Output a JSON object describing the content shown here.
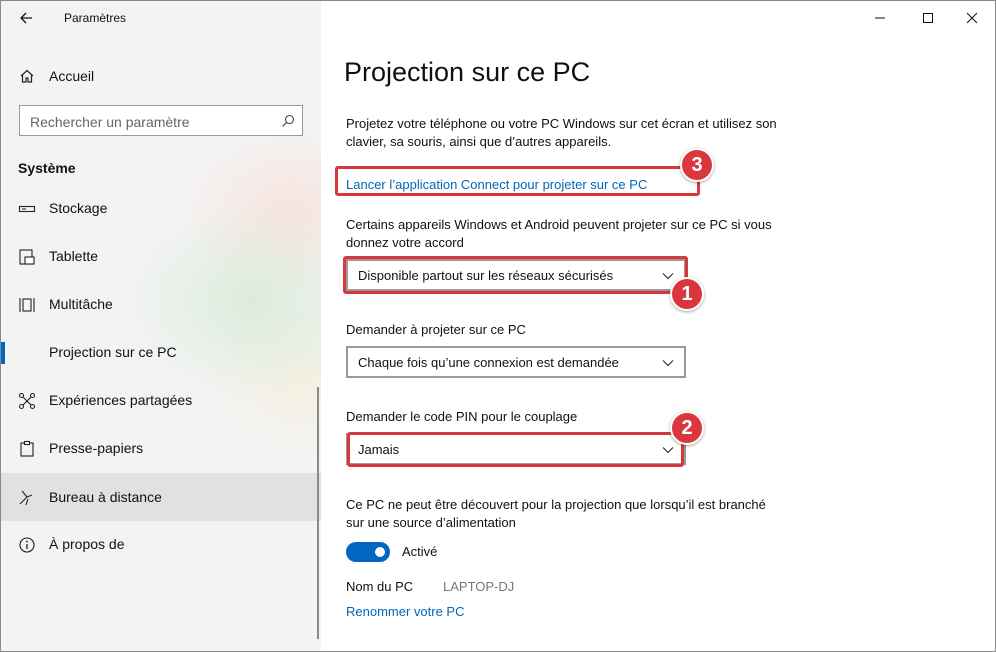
{
  "window": {
    "app_title": "Paramètres"
  },
  "sidebar": {
    "home_label": "Accueil",
    "search_placeholder": "Rechercher un paramètre",
    "section_title": "Système",
    "items": [
      {
        "label": "Stockage",
        "icon": "storage-icon"
      },
      {
        "label": "Tablette",
        "icon": "tablet-icon"
      },
      {
        "label": "Multitâche",
        "icon": "multitask-icon"
      },
      {
        "label": "Projection sur ce PC",
        "icon": "projection-icon",
        "active": true
      },
      {
        "label": "Expériences partagées",
        "icon": "shared-experiences-icon"
      },
      {
        "label": "Presse-papiers",
        "icon": "clipboard-icon"
      },
      {
        "label": "Bureau à distance",
        "icon": "remote-desktop-icon",
        "hovered": true
      },
      {
        "label": "À propos de",
        "icon": "info-icon"
      }
    ]
  },
  "main": {
    "title": "Projection sur ce PC",
    "intro": "Projetez votre téléphone ou votre PC Windows sur cet écran et utilisez son clavier, sa souris, ainsi que d’autres appareils.",
    "connect_link": "Lancer l’application Connect pour projeter sur ce PC",
    "availability_desc": "Certains appareils Windows et Android peuvent projeter sur ce PC si vous donnez votre accord",
    "availability_value": "Disponible partout sur les réseaux sécurisés",
    "ask_label": "Demander à projeter sur ce PC",
    "ask_value": "Chaque fois qu’une connexion est demandée",
    "pin_label": "Demander le code PIN pour le couplage",
    "pin_value": "Jamais",
    "power_desc": "Ce PC ne peut être découvert pour la projection que lorsqu’il est branché sur une source d’alimentation",
    "power_toggle_label": "Activé",
    "power_toggle_on": true,
    "pc_name_label": "Nom du PC",
    "pc_name_value": "LAPTOP-DJ",
    "rename_link": "Renommer votre PC"
  },
  "annotations": {
    "badge_1": "1",
    "badge_2": "2",
    "badge_3": "3"
  },
  "colors": {
    "accent": "#0067c0",
    "link": "#0067b8",
    "annotation_red": "#d9363e"
  }
}
